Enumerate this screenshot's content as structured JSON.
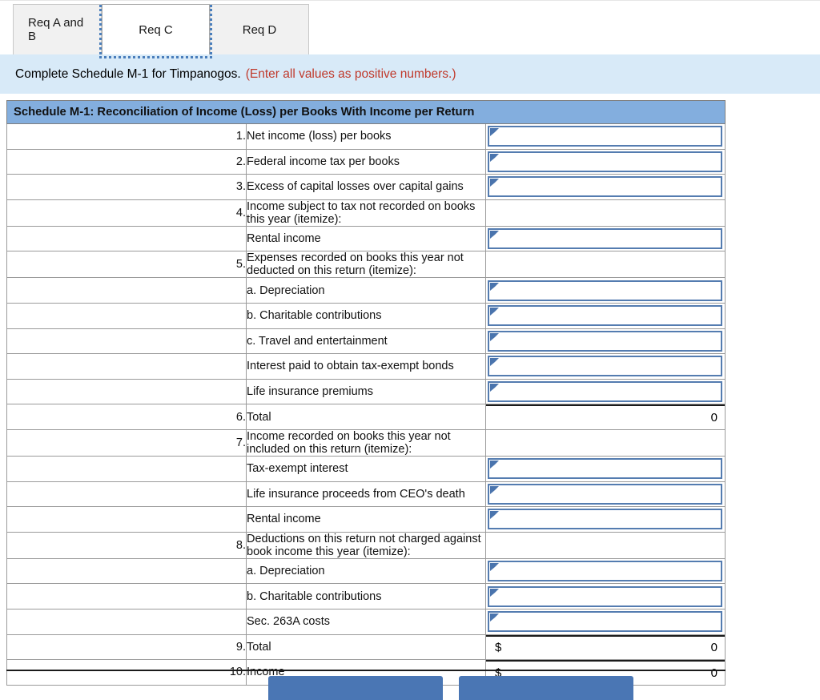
{
  "tabs": [
    {
      "label": "Req A and B",
      "selected": false
    },
    {
      "label": "Req C",
      "selected": true
    },
    {
      "label": "Req D",
      "selected": false
    }
  ],
  "instruction": {
    "text": "Complete Schedule M-1 for Timpanogos.",
    "note": "(Enter all values as positive numbers.)"
  },
  "schedule": {
    "header": "Schedule M-1: Reconciliation of Income (Loss) per Books With Income per Return",
    "rows": [
      {
        "num": "1.",
        "desc": "Net income (loss) per books",
        "cell": "input",
        "value": ""
      },
      {
        "num": "2.",
        "desc": "Federal income tax per books",
        "cell": "input",
        "value": ""
      },
      {
        "num": "3.",
        "desc": "Excess of capital losses over capital gains",
        "cell": "input",
        "value": ""
      },
      {
        "num": "4.",
        "desc": "Income subject to tax not recorded on books this year (itemize):",
        "cell": "empty",
        "value": ""
      },
      {
        "num": "",
        "desc": "Rental income",
        "cell": "input",
        "value": ""
      },
      {
        "num": "5.",
        "desc": "Expenses recorded on books this year not deducted on this return (itemize):",
        "cell": "empty",
        "value": ""
      },
      {
        "num": "",
        "desc": "a. Depreciation",
        "cell": "input",
        "value": ""
      },
      {
        "num": "",
        "desc": "b. Charitable contributions",
        "cell": "input",
        "value": ""
      },
      {
        "num": "",
        "desc": "c. Travel and entertainment",
        "cell": "input",
        "value": ""
      },
      {
        "num": "",
        "desc": "Interest paid to obtain tax-exempt bonds",
        "cell": "input",
        "value": ""
      },
      {
        "num": "",
        "desc": "Life insurance premiums",
        "cell": "input",
        "value": ""
      },
      {
        "num": "6.",
        "desc": "Total",
        "cell": "calc",
        "value": "0"
      },
      {
        "num": "7.",
        "desc": "Income recorded on books this year not included on this return (itemize):",
        "cell": "empty",
        "value": ""
      },
      {
        "num": "",
        "desc": "Tax-exempt interest",
        "cell": "input",
        "value": ""
      },
      {
        "num": "",
        "desc": "Life insurance proceeds from CEO's death",
        "cell": "input",
        "value": ""
      },
      {
        "num": "",
        "desc": "Rental income",
        "cell": "input",
        "value": ""
      },
      {
        "num": "8.",
        "desc": "Deductions on this return not charged against book income this year (itemize):",
        "cell": "empty",
        "value": ""
      },
      {
        "num": "",
        "desc": "a. Depreciation",
        "cell": "input",
        "value": ""
      },
      {
        "num": "",
        "desc": "b. Charitable contributions",
        "cell": "input",
        "value": ""
      },
      {
        "num": "",
        "desc": "Sec. 263A costs",
        "cell": "input",
        "value": ""
      },
      {
        "num": "9.",
        "desc": "Total",
        "cell": "calc-dollar",
        "symbol": "$",
        "value": "0"
      },
      {
        "num": "10.",
        "desc": "Income",
        "cell": "calc-dollar",
        "symbol": "$",
        "value": "0"
      }
    ]
  },
  "footer": {
    "prev_label": "",
    "next_label": ""
  },
  "colors": {
    "header_blue": "#83aede",
    "banner_blue": "#d8eaf8",
    "note_red": "#c0392b",
    "input_border": "#547cb0",
    "button_blue": "#4a76b4"
  }
}
